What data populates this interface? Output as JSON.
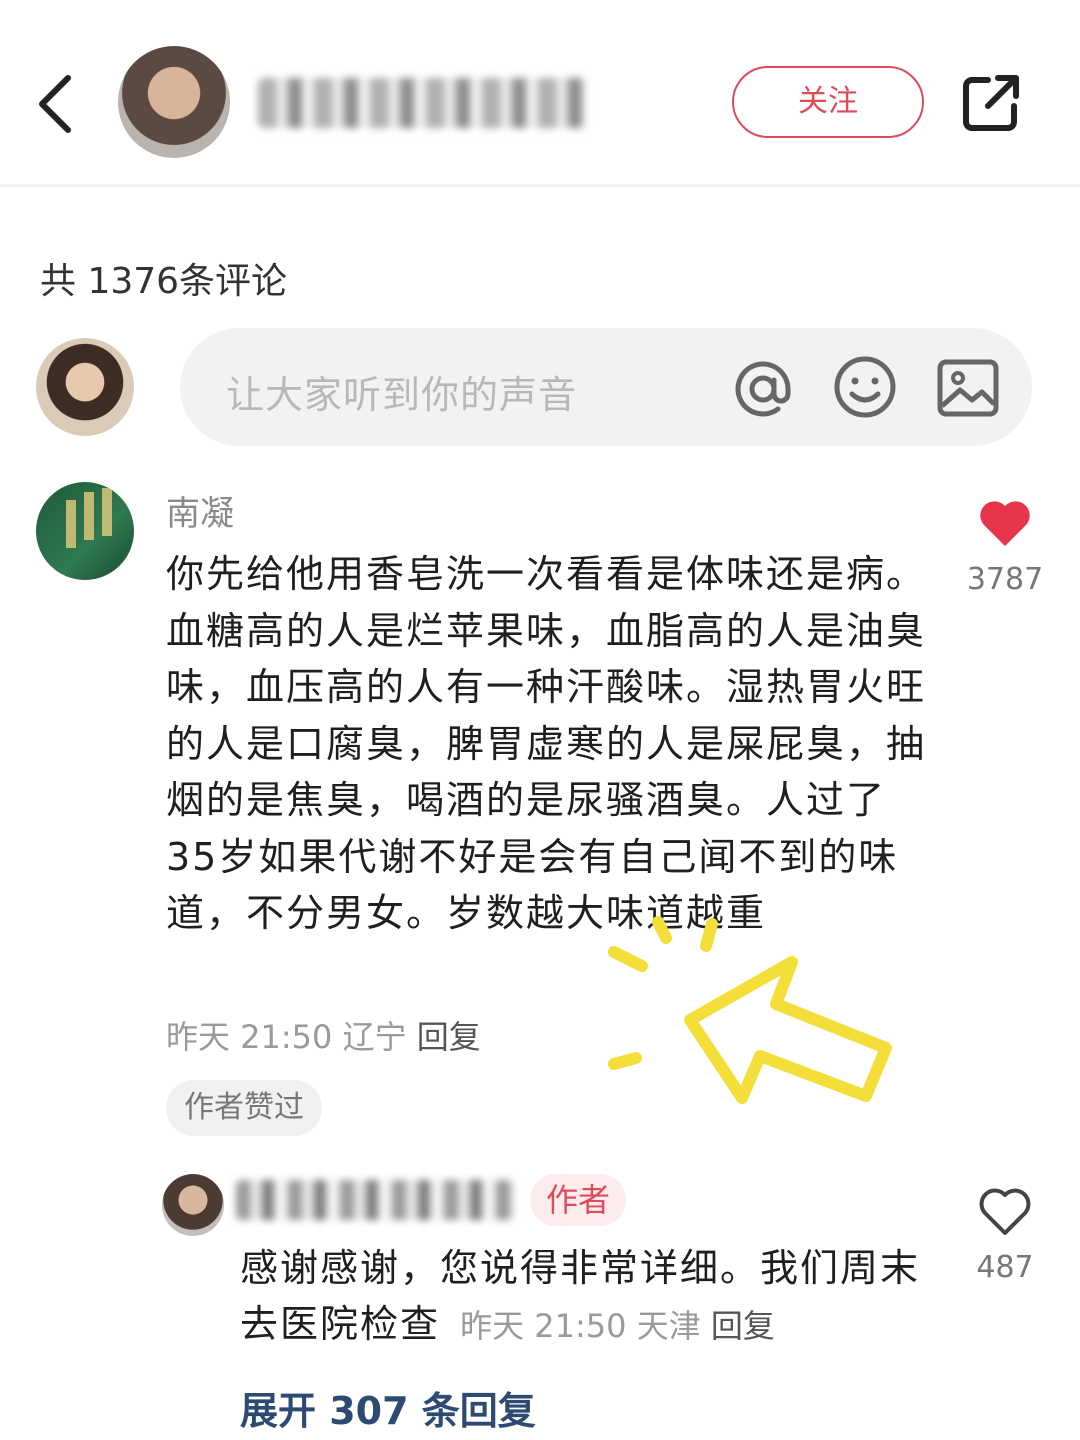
{
  "header": {
    "follow_label": "关注"
  },
  "comments_header": {
    "count_text": "共 1376条评论"
  },
  "input": {
    "placeholder": "让大家听到你的声音"
  },
  "comment": {
    "username": "南凝",
    "text": "你先给他用香皂洗一次看看是体味还是病。血糖高的人是烂苹果味，血脂高的人是油臭味，血压高的人有一种汗酸味。湿热胃火旺的人是口腐臭，脾胃虚寒的人是屎屁臭，抽烟的是焦臭，喝酒的是尿骚酒臭。人过了35岁如果代谢不好是会有自己闻不到的味道，不分男女。岁数越大味道越重",
    "time": "昨天 21:50",
    "location": "辽宁",
    "reply_label": "回复",
    "badge": "作者赞过",
    "like_count": "3787",
    "liked": true
  },
  "reply": {
    "author_tag": "作者",
    "text": "感谢感谢，您说得非常详细。我们周末去医院检查",
    "time": "昨天 21:50",
    "location": "天津",
    "reply_label": "回复",
    "like_count": "487",
    "liked": false
  },
  "expand": {
    "label": "展开 307 条回复"
  },
  "colors": {
    "accent": "#e04b5a",
    "link": "#2c4a72",
    "highlight": "#f3de3a"
  }
}
